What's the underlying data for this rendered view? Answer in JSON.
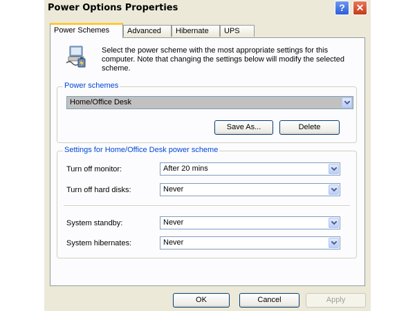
{
  "window": {
    "title": "Power Options Properties",
    "help_glyph": "?",
    "close_glyph": "✕"
  },
  "tabs": [
    {
      "label": "Power Schemes",
      "active": true
    },
    {
      "label": "Advanced",
      "active": false
    },
    {
      "label": "Hibernate",
      "active": false
    },
    {
      "label": "UPS",
      "active": false
    }
  ],
  "description": "Select the power scheme with the most appropriate settings for this computer. Note that changing the settings below will modify the selected scheme.",
  "power_schemes": {
    "group_label": "Power schemes",
    "selected": "Home/Office Desk",
    "save_as_label": "Save As...",
    "delete_label": "Delete"
  },
  "settings": {
    "group_label": "Settings for Home/Office Desk power scheme",
    "monitor_label": "Turn off monitor:",
    "monitor_value": "After 20 mins",
    "hard_disks_label": "Turn off hard disks:",
    "hard_disks_value": "Never",
    "standby_label": "System standby:",
    "standby_value": "Never",
    "hibernate_label": "System hibernates:",
    "hibernate_value": "Never"
  },
  "footer": {
    "ok_label": "OK",
    "cancel_label": "Cancel",
    "apply_label": "Apply"
  },
  "icons": {
    "power_scheme_icon": "computer-with-battery-icon",
    "dropdown_icon": "chevron-down-icon"
  },
  "colors": {
    "window_bg": "#ece9d8",
    "group_label": "#0046d5",
    "tab_highlight": "#ffc83c",
    "close_button": "#c63a18",
    "help_button": "#2b5fd9"
  }
}
